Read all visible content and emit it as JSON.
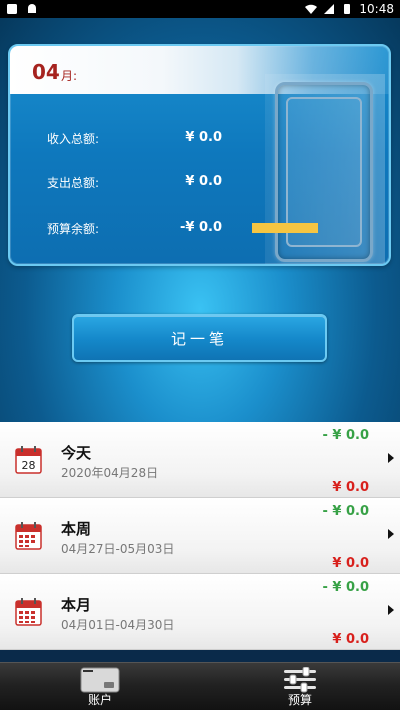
{
  "status_bar": {
    "time": "10:48"
  },
  "summary": {
    "month_number": "04",
    "month_suffix": "月:",
    "rows": [
      {
        "label": "收入总额:",
        "value": "¥ 0.0"
      },
      {
        "label": "支出总额:",
        "value": "¥ 0.0"
      },
      {
        "label": "预算余额:",
        "value": "-¥ 0.0"
      }
    ],
    "budget_bar_color": "#f5c542"
  },
  "record_button": {
    "label": "记一笔"
  },
  "list": [
    {
      "title": "今天",
      "subtitle": "2020年04月28日",
      "expense": "- ¥ 0.0",
      "income": "¥ 0.0",
      "calendar_day": "28",
      "icon": "calendar-day-icon"
    },
    {
      "title": "本周",
      "subtitle": "04月27日-05月03日",
      "expense": "- ¥ 0.0",
      "income": "¥ 0.0",
      "icon": "calendar-grid-icon"
    },
    {
      "title": "本月",
      "subtitle": "04月01日-04月30日",
      "expense": "- ¥ 0.0",
      "income": "¥ 0.0",
      "icon": "calendar-grid-icon"
    }
  ],
  "tabs": [
    {
      "label": "账户",
      "icon": "card-icon"
    },
    {
      "label": "预算",
      "icon": "sliders-icon"
    }
  ],
  "colors": {
    "expense_green": "#37a146",
    "income_red": "#d8201c",
    "month_red": "#a6231f"
  }
}
